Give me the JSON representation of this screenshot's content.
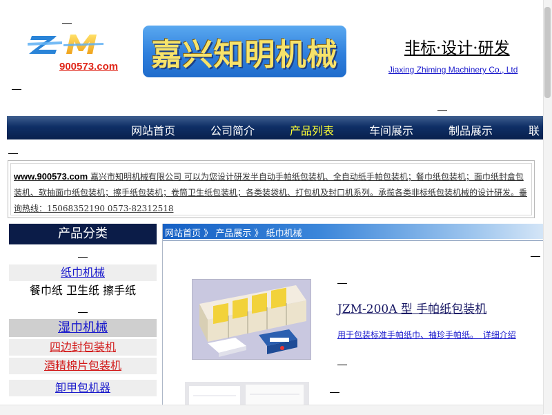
{
  "header": {
    "logo_text": "ZM",
    "domain": "900573.com",
    "banner_text": "嘉兴知明机械",
    "slogan": "非标·设计·研发",
    "company_en": "Jiaxing Zhiming Machinery Co., Ltd"
  },
  "nav": {
    "items": [
      {
        "label": "网站首页"
      },
      {
        "label": "公司简介"
      },
      {
        "label": "产品列表"
      },
      {
        "label": "车间展示"
      },
      {
        "label": "制品展示"
      },
      {
        "label": "联"
      }
    ],
    "active_index": 2
  },
  "intro": {
    "site": "www.900573.com",
    "text": " 嘉兴市知明机械有限公司 可以为您设计研发半自动手帕纸包装机、全自动纸手帕包装机；餐巾纸包装机；面巾纸封盒包装机、软抽面巾纸包装机；擦手纸包装机；卷筒卫生纸包装机；各类装袋机、打包机及封口机系列。承揽各类非标纸包装机械的设计研发。垂询热线：15068352190 0573-82312518"
  },
  "sidebar": {
    "title": "产品分类",
    "items": [
      {
        "label": "纸巾机械"
      },
      {
        "label": "餐巾纸 卫生纸 擦手纸"
      },
      {
        "label": "湿巾机械"
      },
      {
        "label": "四边封包装机"
      },
      {
        "label": "酒精棉片包装机"
      },
      {
        "label": "卸甲包机器"
      }
    ]
  },
  "breadcrumb": {
    "home": "网站首页",
    "sep": " 》",
    "section": " 产品展示",
    "current": " 纸巾机械"
  },
  "product": {
    "title": "JZM-200A 型 手帕纸包装机",
    "desc": "用于包装标准手帕纸巾、袖珍手帕纸。",
    "more": "详细介绍"
  },
  "colors": {
    "nav_bg": "#0f2f66",
    "nav_active": "#ffff33",
    "sidebar_header_bg": "#0b1c48",
    "link_red": "#d21a1a",
    "link_blue": "#1a1acc",
    "banner_text": "#f7e36a"
  }
}
